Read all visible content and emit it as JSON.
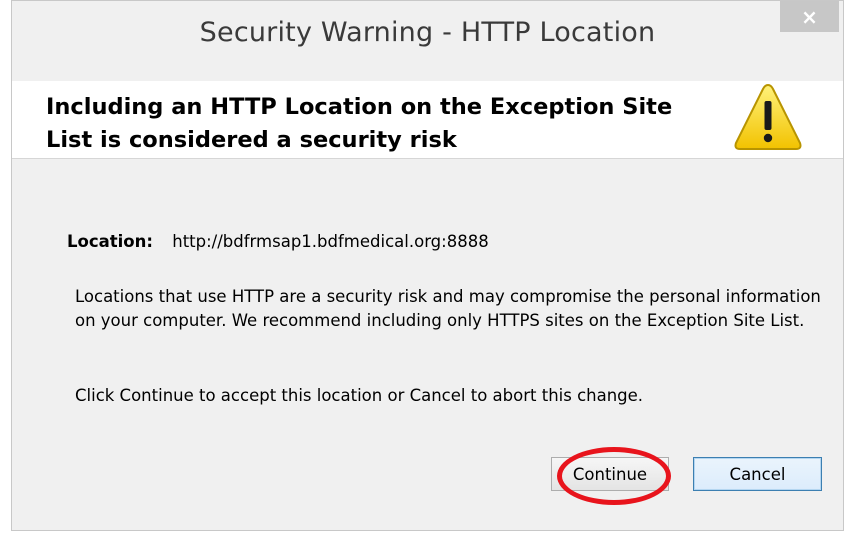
{
  "dialog": {
    "title": "Security Warning - HTTP Location",
    "close_label": "×"
  },
  "header": {
    "message": "Including an HTTP Location on the Exception Site List is considered a security risk",
    "icon": "warning-triangle-icon",
    "icon_color": "#f7d417"
  },
  "body": {
    "location_label": "Location:",
    "location_value": "http://bdfrmsap1.bdfmedical.org:8888",
    "paragraph1": "Locations that use HTTP are a security risk and may compromise the personal information on your computer.  We recommend including only HTTPS sites on the Exception Site List.",
    "paragraph2": "Click Continue to accept this location or Cancel to abort this change."
  },
  "buttons": {
    "continue_label": "Continue",
    "cancel_label": "Cancel"
  },
  "annotation": {
    "highlight_color": "#e8141c"
  }
}
